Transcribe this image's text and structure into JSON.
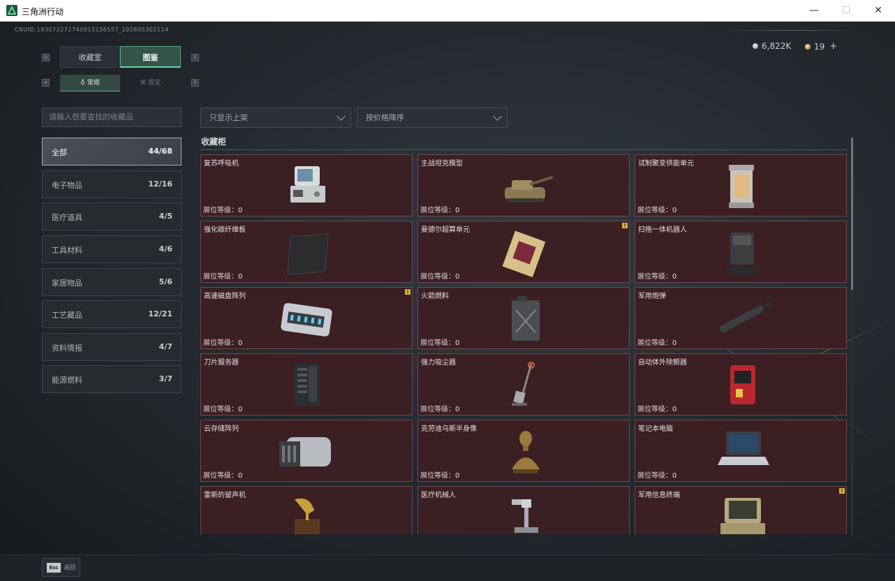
{
  "window": {
    "title": "三角洲行动",
    "minimize": "—",
    "maximize": "☐",
    "close": "✕"
  },
  "header": {
    "uid": "CNUID:183072272740913156557_202605302114",
    "silver": "6,822K",
    "gold": "19",
    "plus": "+"
  },
  "tabs": {
    "collect": "收藏室",
    "book": "图鉴",
    "key_left": "Q",
    "key_right": "E"
  },
  "subtabs": {
    "normal": "常规",
    "limited": "限定",
    "key_left": "A",
    "key_right": "D"
  },
  "search": {
    "placeholder": "请输入想要查找的收藏品"
  },
  "filters": {
    "shelf": "只显示上架",
    "sort": "按价格降序"
  },
  "categories": [
    {
      "label": "全部",
      "count": "44/68"
    },
    {
      "label": "电子物品",
      "count": "12/16"
    },
    {
      "label": "医疗道具",
      "count": "4/5"
    },
    {
      "label": "工具材料",
      "count": "4/6"
    },
    {
      "label": "家居物品",
      "count": "5/6"
    },
    {
      "label": "工艺藏品",
      "count": "12/21"
    },
    {
      "label": "资料情报",
      "count": "4/7"
    },
    {
      "label": "能源燃料",
      "count": "3/7"
    }
  ],
  "section_title": "收藏柜",
  "level_label": "展位等级：",
  "items": [
    {
      "name": "复苏呼吸机",
      "level": "0",
      "icon": "ventilator",
      "badge": ""
    },
    {
      "name": "主战坦克模型",
      "level": "0",
      "icon": "tank-model",
      "badge": ""
    },
    {
      "name": "试制聚变供能单元",
      "level": "0",
      "icon": "fusion-cell",
      "badge": ""
    },
    {
      "name": "强化碳纤维板",
      "level": "0",
      "icon": "carbon-plate",
      "badge": ""
    },
    {
      "name": "曼德尔超算单元",
      "level": "0",
      "icon": "compute-unit",
      "badge": "!"
    },
    {
      "name": "扫拖一体机器人",
      "level": "0",
      "icon": "mop-robot",
      "badge": ""
    },
    {
      "name": "高速磁盘阵列",
      "level": "0",
      "icon": "disk-array",
      "badge": "!"
    },
    {
      "name": "火箭燃料",
      "level": "0",
      "icon": "fuel-can",
      "badge": ""
    },
    {
      "name": "军用炮弹",
      "level": "0",
      "icon": "shell",
      "badge": ""
    },
    {
      "name": "刀片服务器",
      "level": "0",
      "icon": "blade-server",
      "badge": ""
    },
    {
      "name": "强力吸尘器",
      "level": "0",
      "icon": "vacuum",
      "badge": ""
    },
    {
      "name": "自动体外除颤器",
      "level": "0",
      "icon": "defibrillator",
      "badge": ""
    },
    {
      "name": "云存储阵列",
      "level": "0",
      "icon": "cloud-storage",
      "badge": ""
    },
    {
      "name": "克劳迪乌斯半身像",
      "level": "0",
      "icon": "bust",
      "badge": ""
    },
    {
      "name": "笔记本电脑",
      "level": "0",
      "icon": "laptop",
      "badge": ""
    },
    {
      "name": "雷斯的留声机",
      "level": "0",
      "icon": "gramophone",
      "badge": ""
    },
    {
      "name": "医疗机械人",
      "level": "0",
      "icon": "medical-robot",
      "badge": ""
    },
    {
      "name": "军用信息终端",
      "level": "0",
      "icon": "military-terminal",
      "badge": "!"
    }
  ],
  "bottom": {
    "esc_key": "Esc",
    "esc_label": "返回"
  }
}
